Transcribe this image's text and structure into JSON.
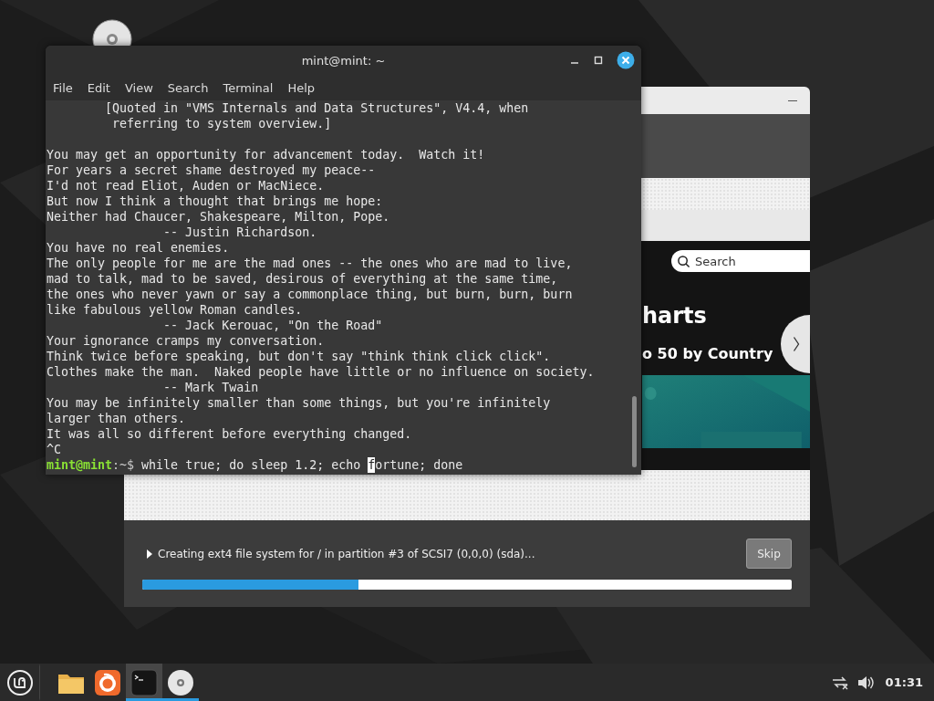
{
  "installer": {
    "slideshow": {
      "search_placeholder": "Search",
      "heading": "harts",
      "subheading": "o 50 by Country"
    },
    "status": "Creating ext4 file system for / in partition #3 of SCSI7 (0,0,0) (sda)...",
    "skip_button": {
      "label": "Skip",
      "disabled": true
    },
    "progress": {
      "level": 0.333
    }
  },
  "terminal": {
    "title": "mint@mint: ~",
    "menu": [
      "File",
      "Edit",
      "View",
      "Search",
      "Terminal",
      "Help"
    ],
    "paragraphs": [
      [
        "        [Quoted in \"VMS Internals and Data Structures\", V4.4, when",
        "         referring to system overview.]"
      ],
      [
        "You may get an opportunity for advancement today.  Watch it!",
        "For years a secret shame destroyed my peace--",
        "I'd not read Eliot, Auden or MacNiece.",
        "But now I think a thought that brings me hope:",
        "Neither had Chaucer, Shakespeare, Milton, Pope.",
        "                -- Justin Richardson.",
        "You have no real enemies.",
        "The only people for me are the mad ones -- the ones who are mad to live,",
        "mad to talk, mad to be saved, desirous of everything at the same time,",
        "the ones who never yawn or say a commonplace thing, but burn, burn, burn",
        "like fabulous yellow Roman candles.",
        "                -- Jack Kerouac, \"On the Road\"",
        "Your ignorance cramps my conversation.",
        "Think twice before speaking, but don't say \"think think click click\".",
        "Clothes make the man.  Naked people have little or no influence on society.",
        "                -- Mark Twain",
        "You may be infinitely smaller than some things, but you're infinitely",
        "larger than others.",
        "It was all so different before everything changed.",
        "^C"
      ]
    ],
    "prompt": {
      "user": "mint@mint",
      "path": ":~$",
      "command_before_cursor": "while true; do sleep 1.2; echo ",
      "cursor_char": "f",
      "command_after_cursor": "ortune; done"
    }
  },
  "taskbar": {
    "apps": [
      {
        "kind": "menu",
        "running": false,
        "focused": false
      },
      {
        "kind": "files",
        "running": false,
        "focused": false
      },
      {
        "kind": "browser",
        "running": false,
        "focused": false
      },
      {
        "kind": "terminal",
        "running": true,
        "focused": true
      },
      {
        "kind": "disc",
        "running": true,
        "focused": false
      }
    ],
    "clock": "01:31"
  }
}
